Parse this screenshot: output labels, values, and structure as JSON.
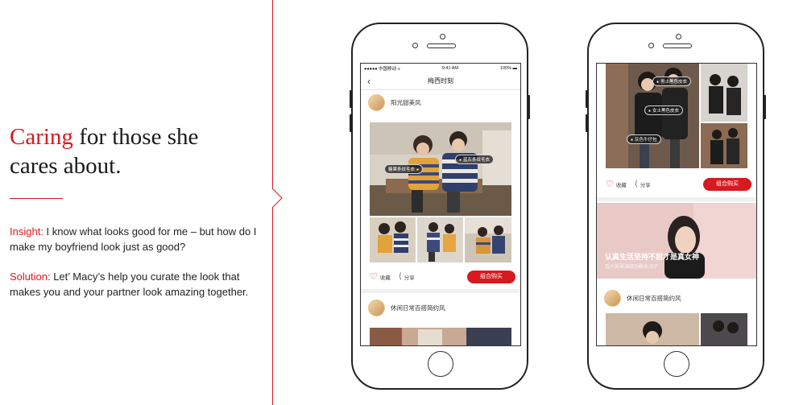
{
  "headline": {
    "accent": "Caring",
    "rest_line1": " for those she",
    "line2": "cares about."
  },
  "insight": {
    "label": "Insight:",
    "text": " I know what looks good for me – but how do I make my boyfriend look just as good?"
  },
  "solution": {
    "label": "Solution:",
    "text": "  Let’ Macy’s help you curate the look that makes you and your partner look amazing together."
  },
  "phone1": {
    "status": {
      "carrier": "●●●●● 中国移动 ≡",
      "time": "9:41 AM",
      "battery": "100% ▬"
    },
    "nav_title": "梅西时刻",
    "back": "‹",
    "post1": {
      "username": "阳光甜美风",
      "tag_left": "糖果条纹毛衣",
      "tag_right": "蓝灰条纹毛衣"
    },
    "actions": {
      "heart": "♡",
      "collect": "收藏",
      "share_icon": "⟨",
      "share": "分享",
      "buy": "组合购买"
    },
    "post2": {
      "username": "休闲日常百搭简约风"
    }
  },
  "phone2": {
    "tags": {
      "t1": "男士黑色皮衣",
      "t2": "女士黑色皮衣",
      "t3": "灰色牛仔包"
    },
    "actions": {
      "heart": "♡",
      "collect": "收藏",
      "share_icon": "⟨",
      "share": "分享",
      "buy": "组合购买"
    },
    "banner": {
      "line1": "认真生活坚持不屈才是真女神",
      "line2": "看大幂幂演绎劲酷女汉子"
    },
    "post": {
      "username": "休闲日常百搭简约风"
    }
  },
  "colors": {
    "accent": "#d71920",
    "text": "#1a1a1a"
  }
}
